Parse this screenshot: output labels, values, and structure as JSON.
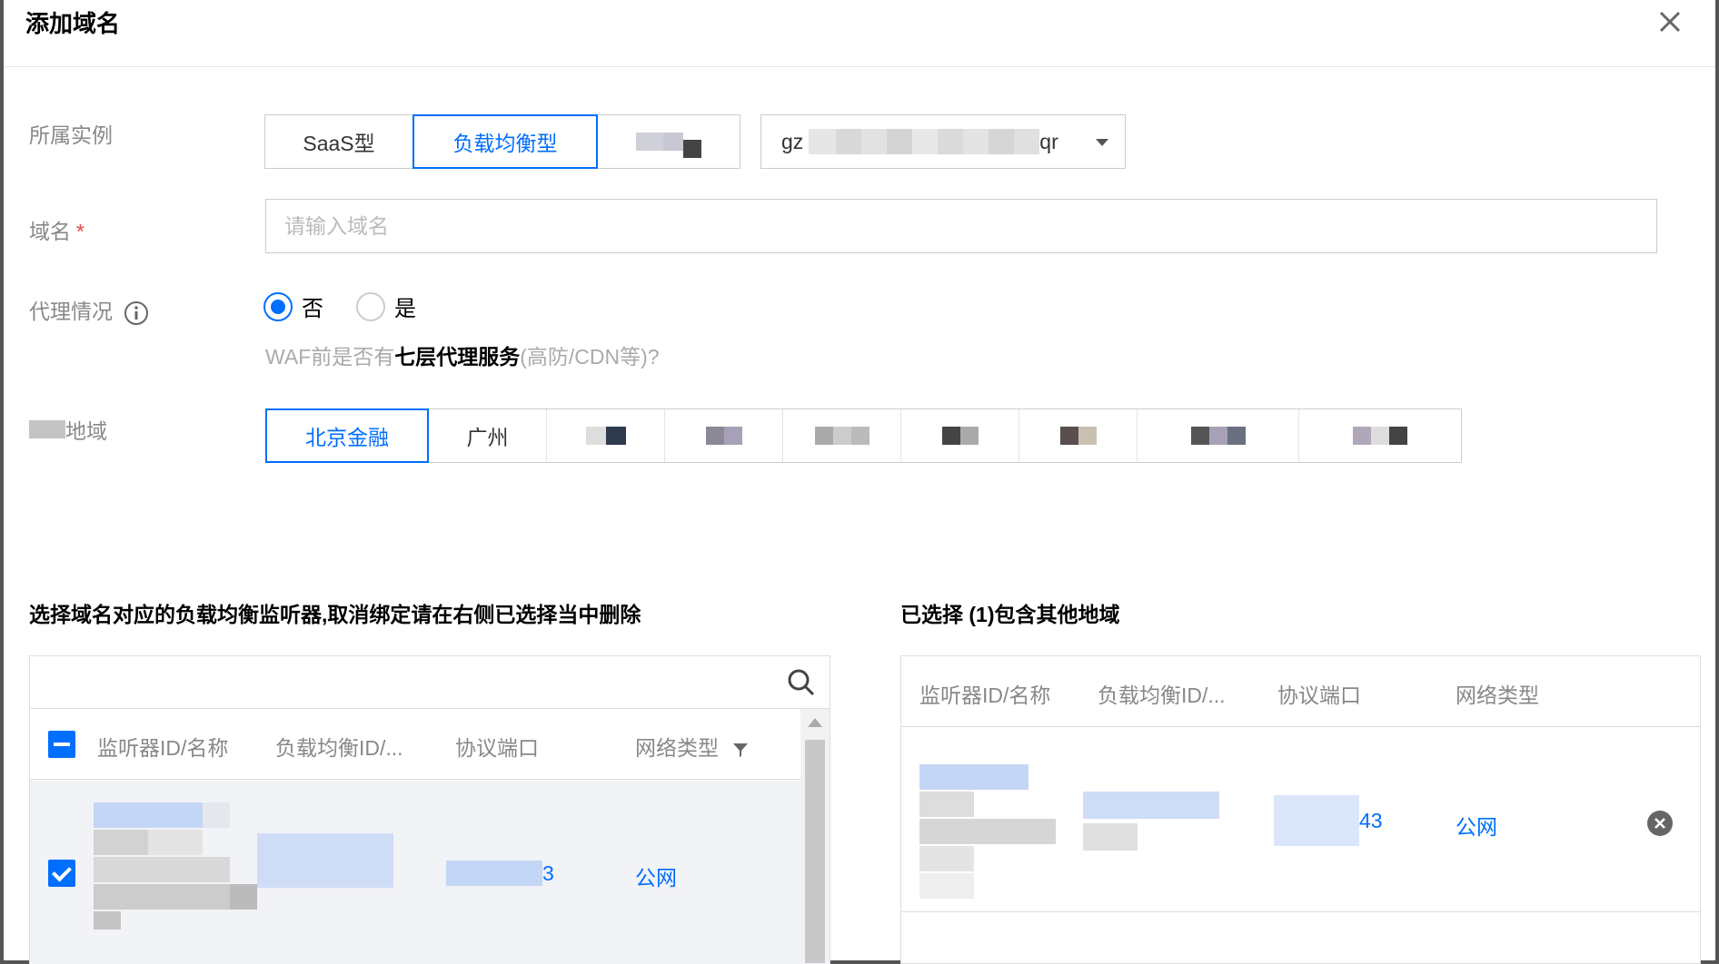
{
  "dialog": {
    "title": "添加域名"
  },
  "form": {
    "instance_label": "所属实例",
    "instance_types": [
      "SaaS型",
      "负载均衡型"
    ],
    "instance_select_prefix": "gz",
    "instance_select_suffix": "qr",
    "domain_label": "域名",
    "domain_required_mark": "*",
    "domain_placeholder": "请输入域名",
    "proxy_label": "代理情况",
    "proxy_options": [
      "否",
      "是"
    ],
    "proxy_selected": "否",
    "hint_prefix": "WAF前是否有",
    "hint_bold": "七层代理服务",
    "hint_suffix": "(高防/CDN等)?",
    "region_label": "地域",
    "regions": [
      "北京金融",
      "广州"
    ],
    "region_selected": "北京金融"
  },
  "left_section": {
    "title": "选择域名对应的负载均衡监听器,取消绑定请在右侧已选择当中删除",
    "columns": [
      "监听器ID/名称",
      "负载均衡ID/...",
      "协议端口",
      "网络类型"
    ],
    "rows": [
      {
        "port_suffix": "3",
        "network": "公网",
        "checked": true
      }
    ]
  },
  "right_section": {
    "title": "已选择 (1)包含其他地域",
    "columns": [
      "监听器ID/名称",
      "负载均衡ID/...",
      "协议端口",
      "网络类型"
    ],
    "rows": [
      {
        "port_suffix": "43",
        "network": "公网"
      }
    ]
  },
  "colors": {
    "accent": "#006eff",
    "required": "#e54545",
    "muted": "#888888"
  },
  "icons": [
    "close-icon",
    "info-icon",
    "search-icon",
    "filter-icon",
    "remove-icon",
    "caret-down-icon"
  ]
}
